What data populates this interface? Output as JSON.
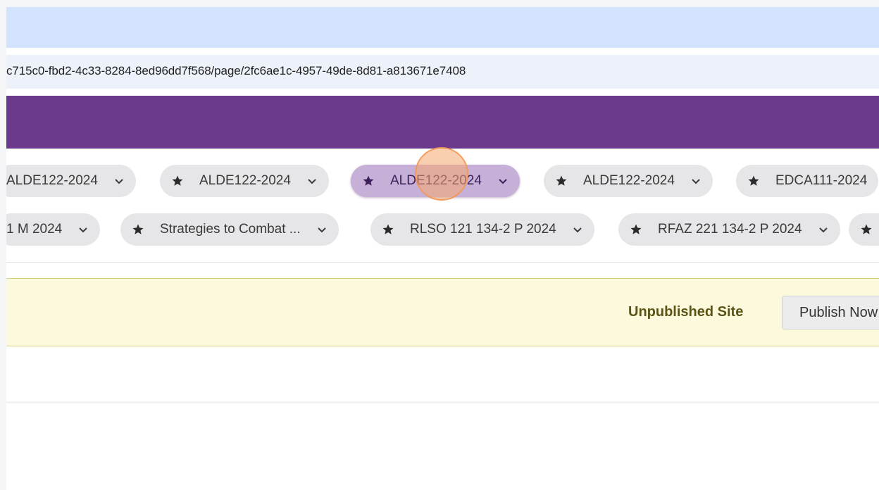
{
  "browser": {
    "url": "c715c0-fbd2-4c33-8284-8ed96dd7f568/page/2fc6ae1c-4957-49de-8d81-a813671e7408"
  },
  "course_chips": {
    "row1": [
      {
        "label": "ALDE122-2024",
        "starred": false,
        "active": false
      },
      {
        "label": "ALDE122-2024",
        "starred": true,
        "active": false
      },
      {
        "label": "ALDE122-2024",
        "starred": true,
        "active": true
      },
      {
        "label": "ALDE122-2024",
        "starred": true,
        "active": false
      },
      {
        "label": "EDCA111-2024",
        "starred": true,
        "active": false
      }
    ],
    "row2": [
      {
        "label": "1 M 2024",
        "starred": false,
        "active": false
      },
      {
        "label": "Strategies to Combat ...",
        "starred": true,
        "active": false
      },
      {
        "label": "RLSO 121 134-2 P 2024",
        "starred": true,
        "active": false
      },
      {
        "label": "RFAZ 221 134-2 P 2024",
        "starred": true,
        "active": false
      }
    ]
  },
  "banner": {
    "status_text": "Unpublished Site",
    "publish_button": "Publish Now"
  },
  "colors": {
    "header_purple": "#6b3a8c",
    "chip_active": "#c7b0d8",
    "banner_bg": "#fdf9dc"
  }
}
